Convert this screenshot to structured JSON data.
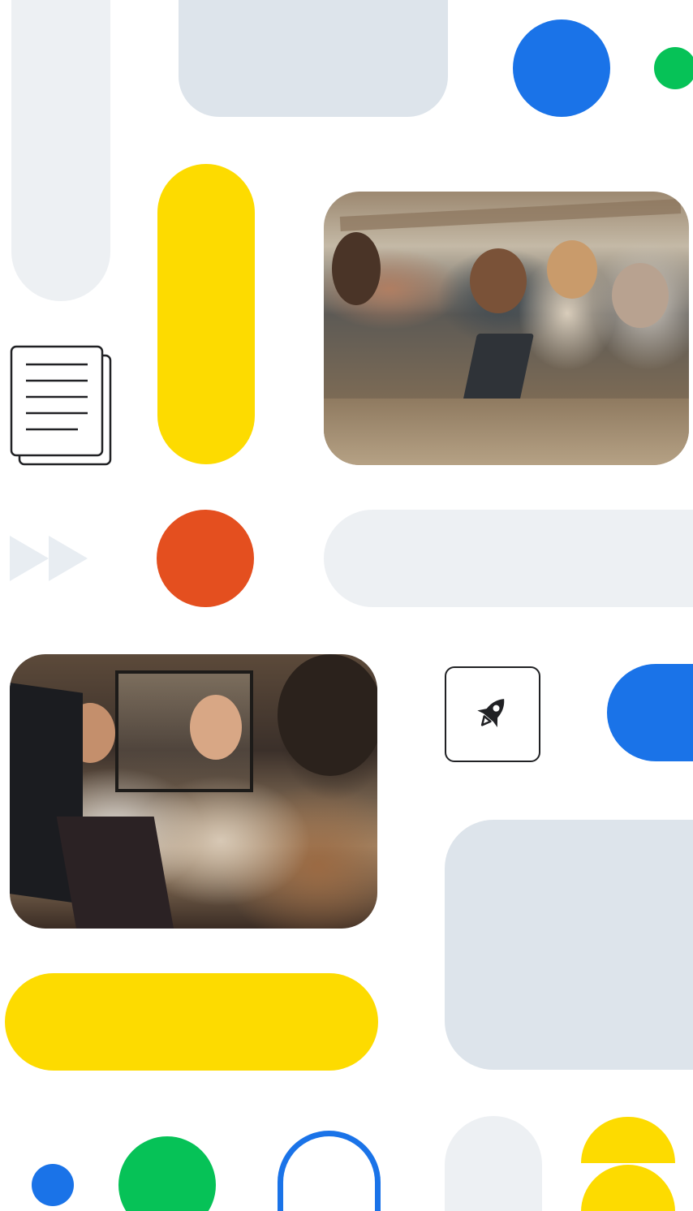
{
  "palette": {
    "blue": "#1a73e8",
    "green": "#06c257",
    "yellow": "#fddb00",
    "orange": "#e44f1f",
    "light_gray": "#edf0f3",
    "slate_gray": "#dde4eb",
    "ink": "#202124"
  },
  "icons": {
    "document": "document-icon",
    "fast_forward": "fast-forward-icon",
    "rocket": "rocket-icon"
  },
  "photos": [
    {
      "name": "team-collaborating-photo"
    },
    {
      "name": "office-coworkers-photo"
    }
  ]
}
